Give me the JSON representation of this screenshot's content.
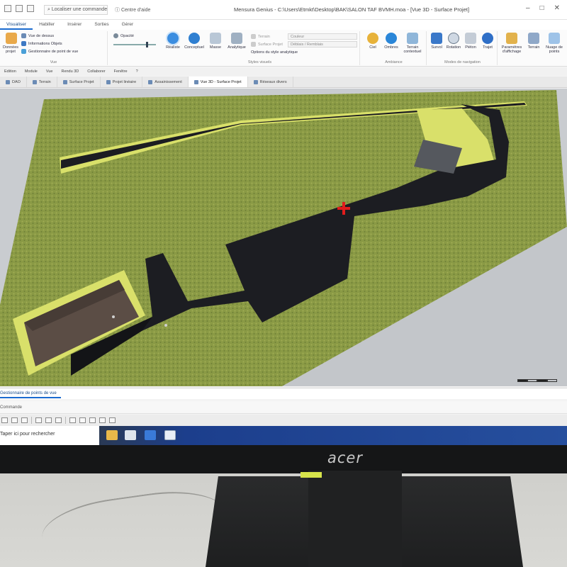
{
  "app": {
    "title": "Mensura Genius - C:\\Users\\Etmkt\\Desktop\\BAK\\SALON TAF BVMH.moa - [Vue 3D - Surface Projet]",
    "search_placeholder": "Localiser une commande",
    "help_label": "Centre d'aide",
    "window_controls": [
      "–",
      "□",
      "✕"
    ]
  },
  "ribbon": {
    "tabs": [
      "Visualiser",
      "Habiller",
      "Insérer",
      "Sorties",
      "Gérer"
    ],
    "active_tab": "Visualiser",
    "vue_group": {
      "label": "Vue",
      "large_button": "Données projet",
      "items": [
        "Vue de dessus",
        "Informations Objets",
        "Gestionnaire de point de vue"
      ]
    },
    "opacity_label": "Opacité",
    "styles_group": {
      "label": "Styles visuels",
      "buttons": [
        "Réaliste",
        "Conceptuel",
        "Masse",
        "Analytique"
      ],
      "active_button": "Réaliste",
      "terrain_label": "Terrain",
      "terrain_value": "Couleur",
      "surface_label": "Surface Projet",
      "surface_value": "Déblais / Remblais",
      "options_label": "Options du style analytique"
    },
    "ambiance_group": {
      "label": "Ambiance",
      "buttons": [
        "Ciel",
        "Ombres",
        "Terrain contextuel"
      ]
    },
    "navigation_group": {
      "label": "Modes de navigation",
      "buttons": [
        "Survol",
        "Rotation",
        "Piéton",
        "Trajet"
      ]
    },
    "display_group": {
      "buttons": [
        "Paramètres d'affichage",
        "Terrain",
        "Nuage de points"
      ]
    }
  },
  "menubar": [
    "Edition",
    "Module",
    "Vue",
    "Rendu 3D",
    "Collaborer",
    "Fenêtre",
    "?"
  ],
  "doc_tabs": [
    {
      "label": "DAO",
      "active": false
    },
    {
      "label": "Terrain",
      "active": false
    },
    {
      "label": "Surface Projet",
      "active": false
    },
    {
      "label": "Projet linéaire",
      "active": false
    },
    {
      "label": "Assainissement",
      "active": false
    },
    {
      "label": "Vue 3D - Surface Projet",
      "active": true
    },
    {
      "label": "Réseaux divers",
      "active": false
    }
  ],
  "bottom": {
    "panel_tab": "Gestionnaire de points de vue",
    "command_label": "Commande"
  },
  "taskbar": {
    "search_text": "Taper ici pour rechercher"
  },
  "monitor": {
    "brand": "acer"
  },
  "colors": {
    "grass": "#8a9a45",
    "asphalt": "#1c1d22",
    "sidewalk": "#d9e06a",
    "roof": "#5b4d45",
    "accent": "#1a6bd0"
  }
}
